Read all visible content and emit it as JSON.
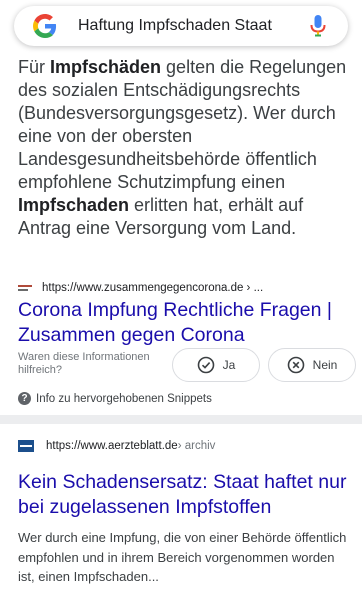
{
  "search": {
    "query": "Haftung Impfschaden Staat"
  },
  "snippet": {
    "p1": "Für ",
    "b1": "Impfschäden",
    "p2": " gelten die Regelungen des sozialen Entschädigungsrechts (Bundesversorgungsgesetz). Wer durch eine von der obersten Landesgesundheitsbehörde öffentlich empfohlene Schutzimpfung einen ",
    "b2": "Impfschaden",
    "p3": " erlitten hat, erhält auf Antrag eine Versorgung vom Land."
  },
  "result1": {
    "url": "https://www.zusammengegencorona.de › ...",
    "title": "Corona Impfung Rechtliche Fragen | Zusammen gegen Corona"
  },
  "feedback": {
    "question": "Waren diese Informationen hilfreich?",
    "yes_label": "Ja",
    "no_label": "Nein"
  },
  "info": {
    "label": "Info zu hervorgehobenen Snippets",
    "icon": "help-icon"
  },
  "result2": {
    "url": "https://www.aerzteblatt.de",
    "path": " › archiv",
    "title": "Kein Schadensersatz: Staat haftet nur bei zugelassenen Impfstoffen",
    "description": "Wer durch eine Impfung, die von einer Behörde öffentlich empfohlen und in ihrem Bereich vorgenommen worden ist, einen Impfschaden..."
  },
  "colors": {
    "link": "#1a0dab",
    "text": "#3c4043",
    "muted": "#70757a",
    "divider": "#ecedef"
  }
}
